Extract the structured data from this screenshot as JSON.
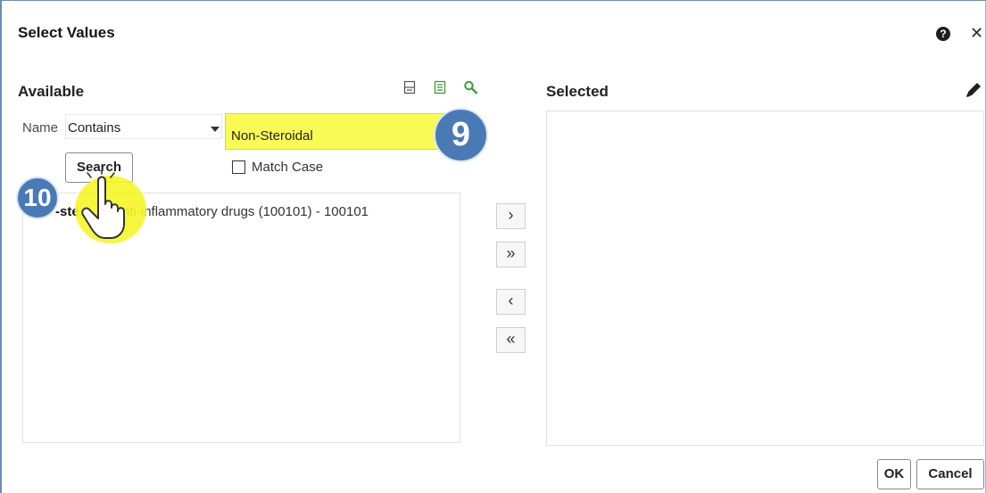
{
  "dialog": {
    "title": "Select Values",
    "help_glyph": "?",
    "close_glyph": "✕"
  },
  "available": {
    "heading": "Available",
    "name_label": "Name",
    "operator": "Contains",
    "search_value": "Non-Steroidal",
    "search_button": "Search",
    "match_case_label": "Match Case",
    "match_case_checked": false,
    "items": [
      "Non-steroidal anti-inflammatory drugs (100101) - 100101"
    ],
    "visible_item_text": "anti-inflammatory drugs (100101) - 100101",
    "item_fragment": "-ste"
  },
  "selected": {
    "heading": "Selected",
    "items": []
  },
  "move_buttons": {
    "move": "›",
    "move_all": "»",
    "remove": "‹",
    "remove_all": "«"
  },
  "footer": {
    "ok": "OK",
    "cancel": "Cancel"
  },
  "annotations": {
    "step_9": "9",
    "step_10": "10"
  },
  "icons": {
    "toolbar": [
      "collapse-list-icon",
      "expand-list-icon",
      "search-icon"
    ],
    "edit": "pencil-icon",
    "pointer": "hand-pointer-icon"
  },
  "colors": {
    "highlight": "#fafa55",
    "badge": "#4a7ab5",
    "search_icon": "#3c9c3c"
  }
}
